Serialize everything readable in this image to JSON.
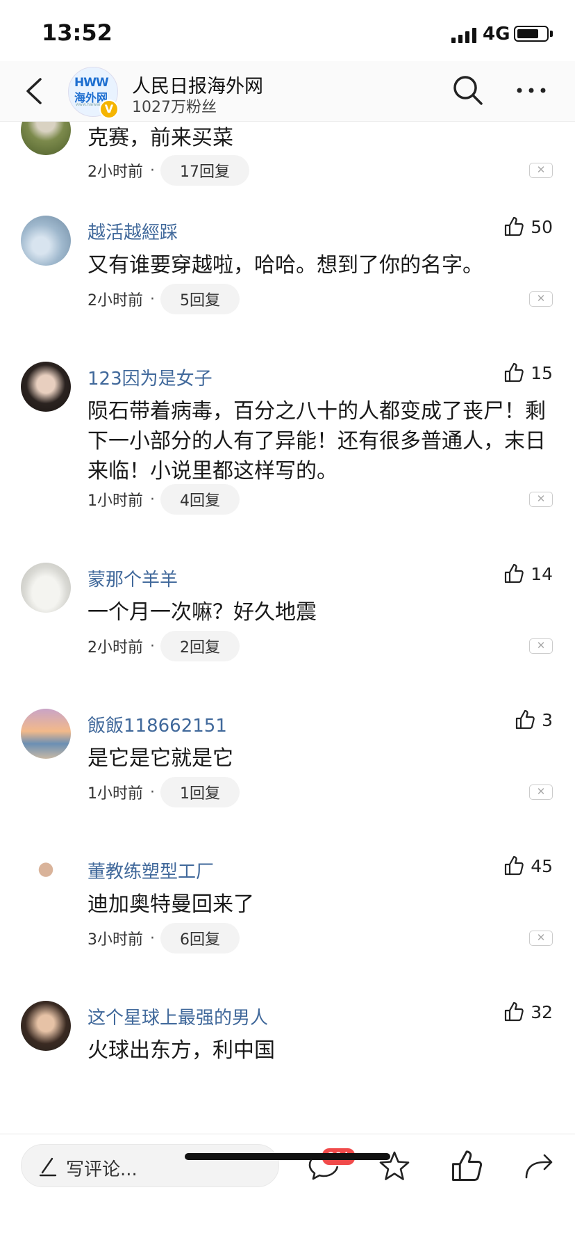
{
  "status": {
    "time": "13:52",
    "network": "4G"
  },
  "header": {
    "title": "人民日报海外网",
    "followers": "1027万粉丝",
    "logo_text": "HWW",
    "logo_cn": "海外网",
    "logo_url": "www.haiwainet.cn",
    "verified_mark": "V"
  },
  "comments": [
    {
      "user": "",
      "text": "克赛，前来买菜",
      "time": "2小时前",
      "replies": "17回复",
      "likes": ""
    },
    {
      "user": "越活越經踩",
      "text": "又有谁要穿越啦，哈哈。想到了你的名字。",
      "time": "2小时前",
      "replies": "5回复",
      "likes": "50"
    },
    {
      "user": "123因为是女子",
      "text": "陨石带着病毒，百分之八十的人都变成了丧尸！剩下一小部分的人有了异能！还有很多普通人，末日来临！小说里都这样写的。",
      "time": "1小时前",
      "replies": "4回复",
      "likes": "15"
    },
    {
      "user": "蒙那个羊羊",
      "text": "一个月一次嘛？好久地震",
      "time": "2小时前",
      "replies": "2回复",
      "likes": "14"
    },
    {
      "user": "飯飯118662151",
      "text": "是它是它就是它",
      "time": "1小时前",
      "replies": "1回复",
      "likes": "3"
    },
    {
      "user": "董教练塑型工厂",
      "text": "迪加奥特曼回来了",
      "time": "3小时前",
      "replies": "6回复",
      "likes": "45"
    },
    {
      "user": "这个星球上最强的男人",
      "text": "火球出东方，利中国",
      "time": "",
      "replies": "",
      "likes": "32"
    }
  ],
  "meta_separator": "·",
  "dismiss_mark": "✕",
  "bottom": {
    "placeholder": "写评论...",
    "comment_count": "204"
  },
  "colors": {
    "username": "#41699b",
    "badge": "#f04a4a",
    "verified": "#f5b400"
  }
}
